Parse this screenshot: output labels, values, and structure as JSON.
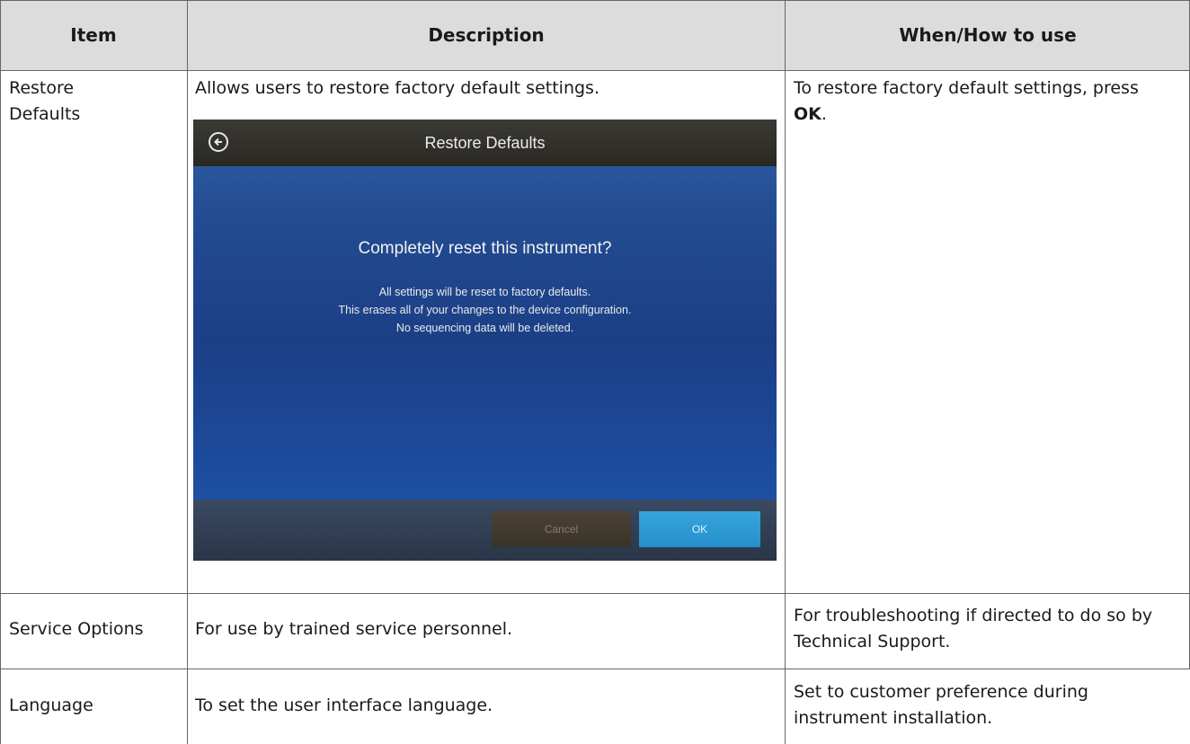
{
  "headers": {
    "item": "Item",
    "description": "Description",
    "when_how": "When/How to use"
  },
  "rows": [
    {
      "item": "Restore Defaults",
      "description": "Allows users to restore factory default settings.",
      "when_how_pre": "To restore factory default settings, press ",
      "when_how_bold": "OK",
      "when_how_post": "."
    },
    {
      "item": "Service Options",
      "description": "For use by trained service personnel.",
      "when_how": "For troubleshooting if directed to do so by Technical Support."
    },
    {
      "item": "Language",
      "description": "To set the user interface language.",
      "when_how": "Set to customer preference during instrument installation."
    }
  ],
  "screenshot": {
    "title": "Restore Defaults",
    "heading": "Completely reset this instrument?",
    "message_lines": [
      "All settings will be reset to factory defaults.",
      "This erases all of your changes to the device configuration.",
      "No sequencing data will be deleted."
    ],
    "cancel_label": "Cancel",
    "ok_label": "OK",
    "icons": [
      "back-arrow-icon"
    ],
    "colors": {
      "ok_button": "#2f9bd6",
      "background": "#1e448c",
      "title_bar": "#33312c"
    }
  }
}
